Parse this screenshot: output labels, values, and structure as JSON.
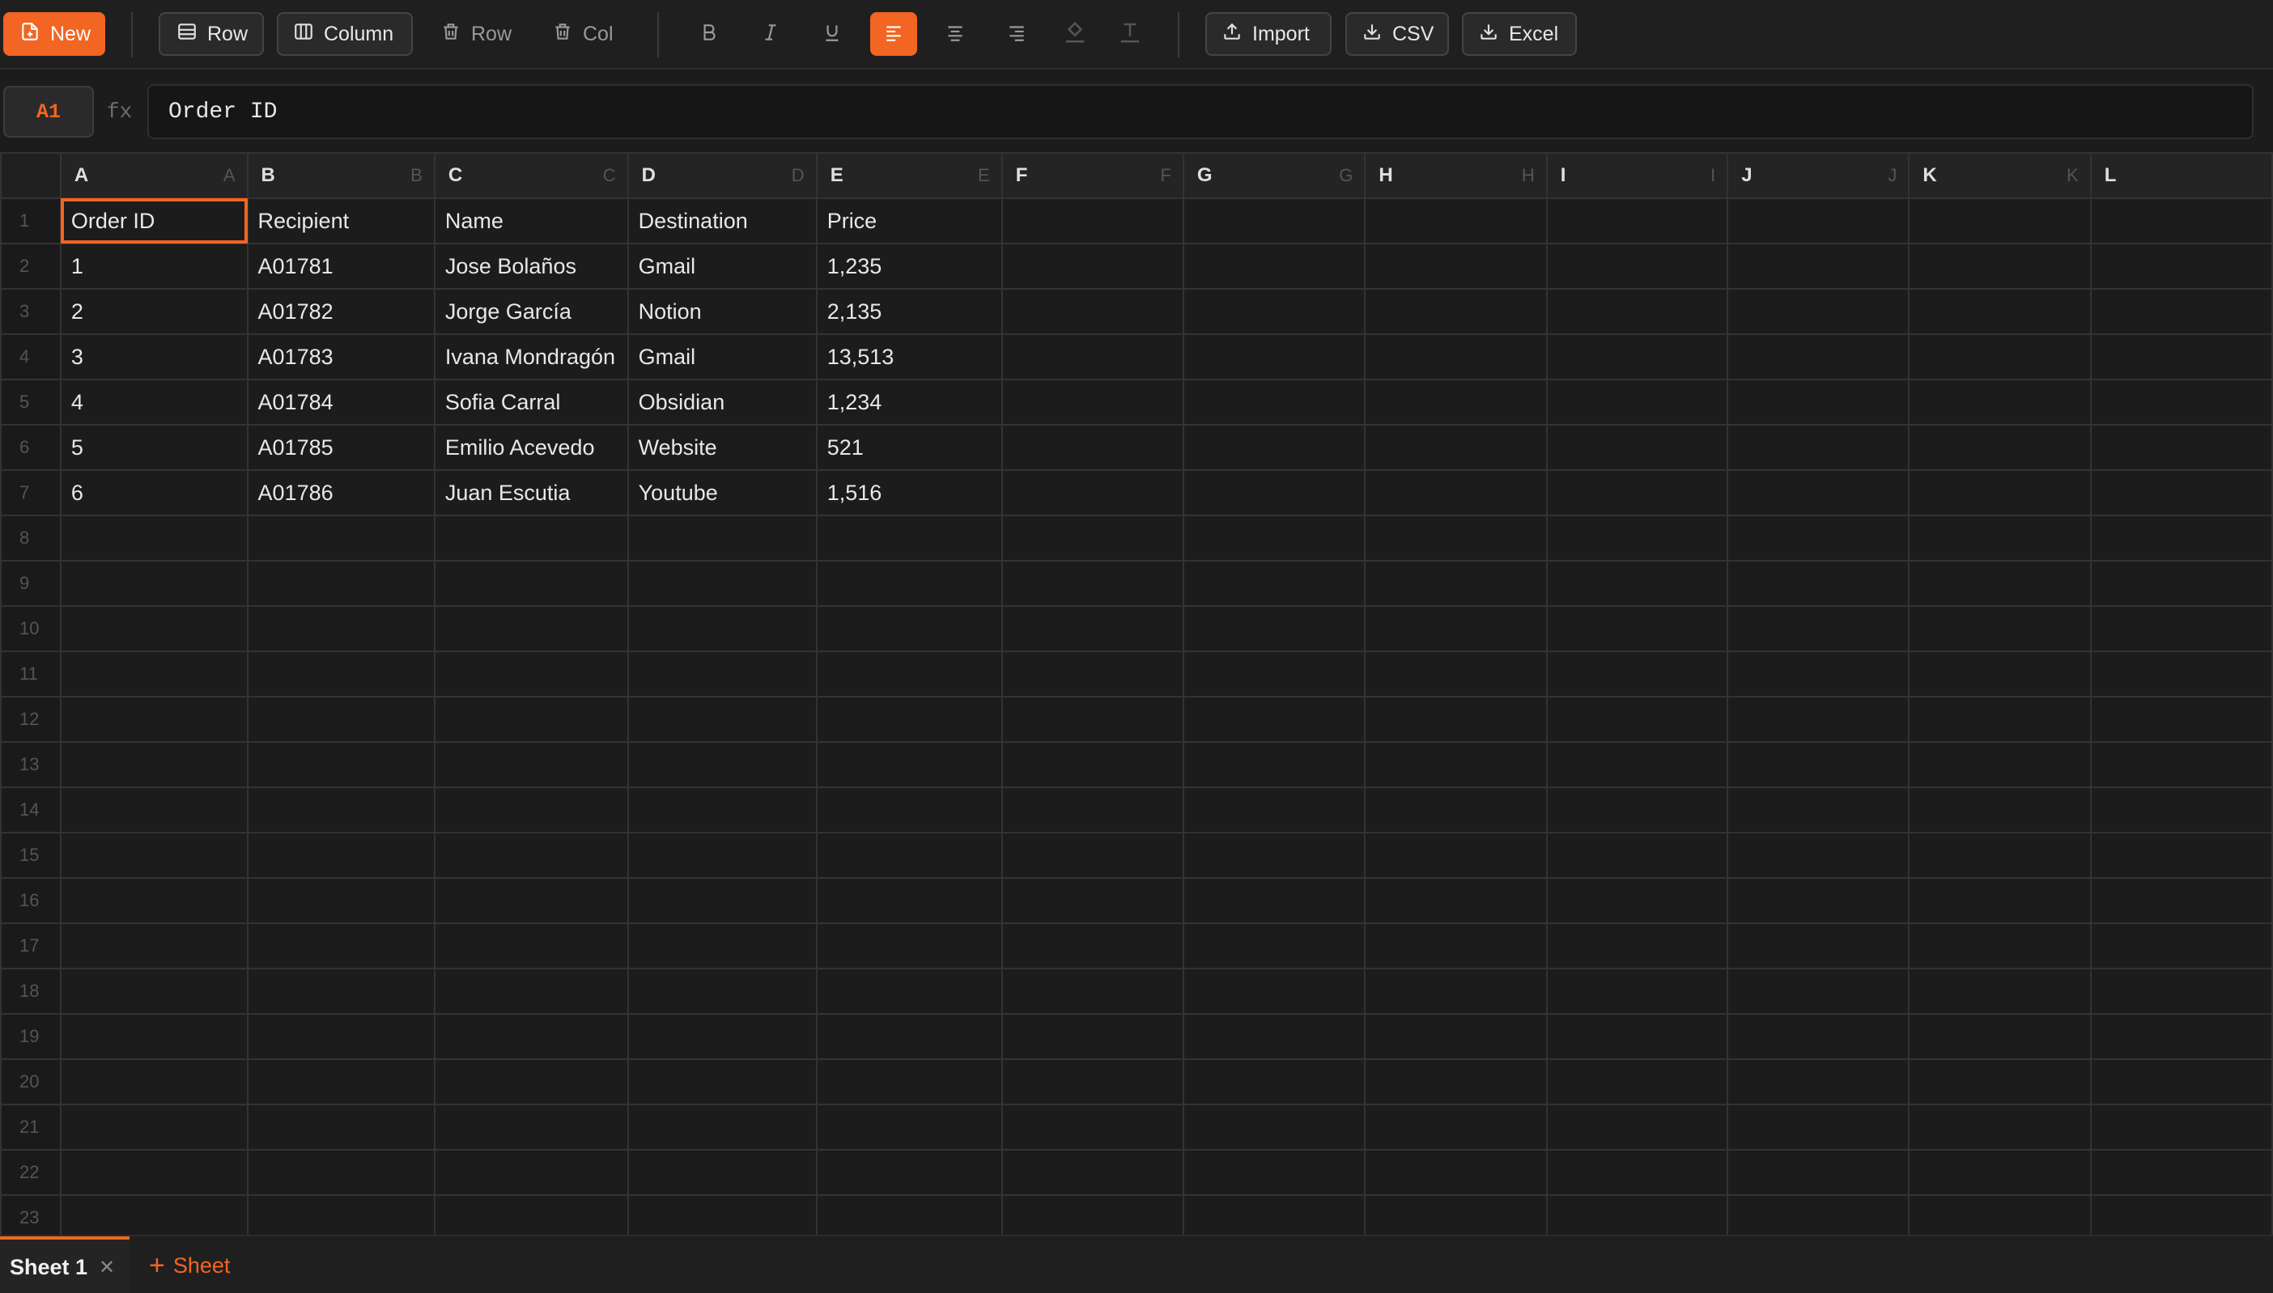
{
  "toolbar": {
    "new_label": "New",
    "add_row_label": "Row",
    "add_column_label": "Column",
    "delete_row_label": "Row",
    "delete_col_label": "Col",
    "import_label": "Import",
    "csv_label": "CSV",
    "excel_label": "Excel",
    "accent_color": "#f26522",
    "icons": [
      "new-file-icon",
      "insert-row-icon",
      "insert-column-icon",
      "trash-icon",
      "bold-icon",
      "italic-icon",
      "underline-icon",
      "align-left-icon",
      "align-center-icon",
      "align-right-icon",
      "fill-color-icon",
      "text-color-icon",
      "upload-icon",
      "download-icon"
    ]
  },
  "formula_bar": {
    "cell_ref": "A1",
    "fx_label": "fx",
    "value": "Order ID"
  },
  "grid": {
    "columns": [
      "A",
      "B",
      "C",
      "D",
      "E",
      "F",
      "G",
      "H",
      "I",
      "J",
      "K",
      "L"
    ],
    "row_numbers": [
      "1",
      "2",
      "3",
      "4",
      "5",
      "6",
      "7",
      "8",
      "9",
      "10",
      "11",
      "12",
      "13",
      "14",
      "15",
      "16",
      "17",
      "18",
      "19",
      "20",
      "21",
      "22",
      "23"
    ],
    "rows": [
      [
        "Order ID",
        "Recipient",
        "Name",
        "Destination",
        "Price"
      ],
      [
        "1",
        "A01781",
        "Jose Bolaños",
        "Gmail",
        "1,235"
      ],
      [
        "2",
        "A01782",
        "Jorge García",
        "Notion",
        "2,135"
      ],
      [
        "3",
        "A01783",
        "Ivana Mondragón",
        "Gmail",
        "13,513"
      ],
      [
        "4",
        "A01784",
        "Sofia Carral",
        "Obsidian",
        "1,234"
      ],
      [
        "5",
        "A01785",
        "Emilio Acevedo",
        "Website",
        "521"
      ],
      [
        "6",
        "A01786",
        "Juan Escutia",
        "Youtube",
        "1,516"
      ]
    ],
    "selected_cell": "A1"
  },
  "sheets": {
    "tabs": [
      {
        "label": "Sheet 1",
        "active": true
      }
    ],
    "add_label": "Sheet"
  }
}
